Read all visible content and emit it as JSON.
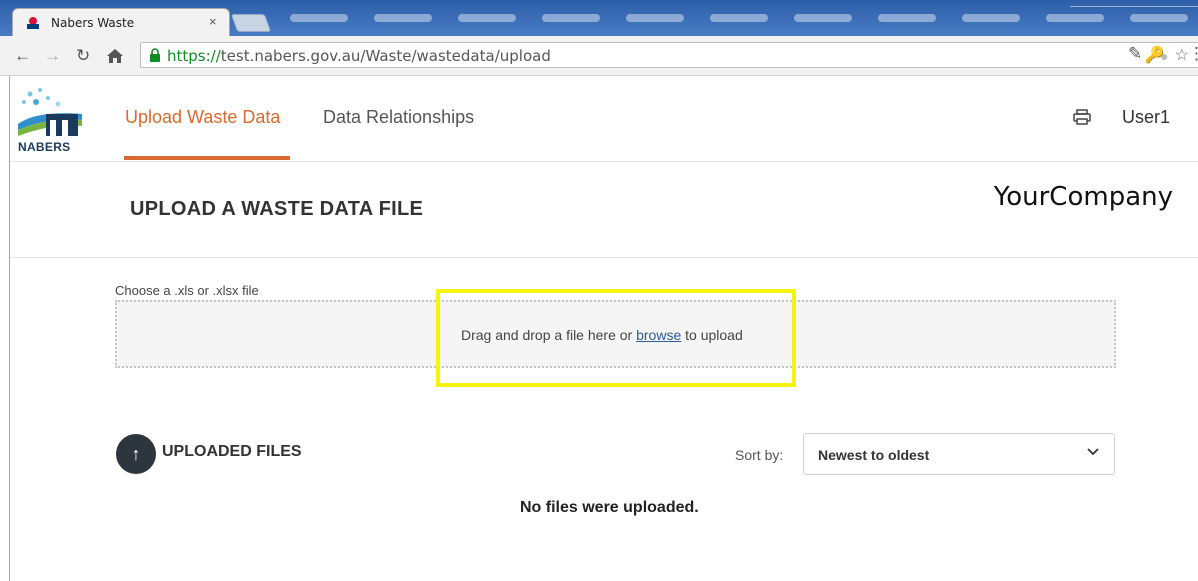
{
  "browser": {
    "tab_title": "Nabers Waste",
    "tab_close": "×",
    "url_scheme": "https://",
    "url_rest": "test.nabers.gov.au/Waste/wastedata/upload"
  },
  "header": {
    "logo_text": "NABERS",
    "nav": {
      "upload": "Upload Waste Data",
      "relationships": "Data Relationships"
    },
    "user": "User1"
  },
  "page": {
    "title": "UPLOAD A WASTE DATA FILE",
    "company": "YourCompany"
  },
  "upload": {
    "choose_label": "Choose a .xls or .xlsx file",
    "drop_text_before": "Drag and drop a file here or ",
    "browse_link": "browse",
    "drop_text_after": " to upload"
  },
  "files": {
    "title": "UPLOADED FILES",
    "sort_label": "Sort by:",
    "sort_selected": "Newest to oldest",
    "empty": "No files were uploaded."
  },
  "colors": {
    "accent": "#d9692c",
    "highlight": "#f4f40e",
    "dark": "#2d353d"
  }
}
